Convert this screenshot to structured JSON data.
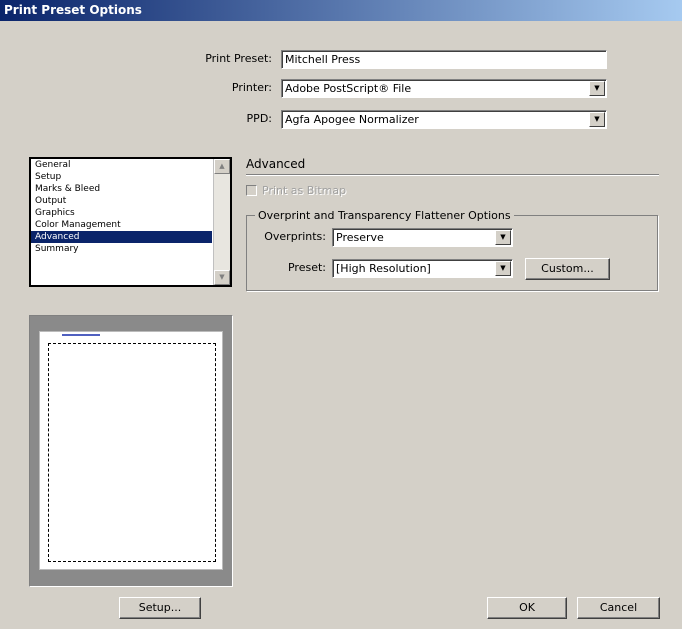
{
  "dialog": {
    "title": "Print Preset Options"
  },
  "header": {
    "print_preset_label": "Print Preset:",
    "print_preset_value": "Mitchell Press",
    "printer_label": "Printer:",
    "printer_value": "Adobe PostScript® File",
    "ppd_label": "PPD:",
    "ppd_value": "Agfa Apogee Normalizer"
  },
  "sidebar": {
    "items": [
      "General",
      "Setup",
      "Marks & Bleed",
      "Output",
      "Graphics",
      "Color Management",
      "Advanced",
      "Summary"
    ],
    "selected": "Advanced"
  },
  "advanced": {
    "section_title": "Advanced",
    "print_as_bitmap": {
      "label": "Print as Bitmap",
      "checked": false,
      "enabled": false
    },
    "group_title": "Overprint and Transparency Flattener Options",
    "overprints_label": "Overprints:",
    "overprints_value": "Preserve",
    "preset_label": "Preset:",
    "preset_value": "[High Resolution]",
    "custom_button": "Custom..."
  },
  "footer": {
    "setup_button": "Setup...",
    "ok_button": "OK",
    "cancel_button": "Cancel"
  }
}
